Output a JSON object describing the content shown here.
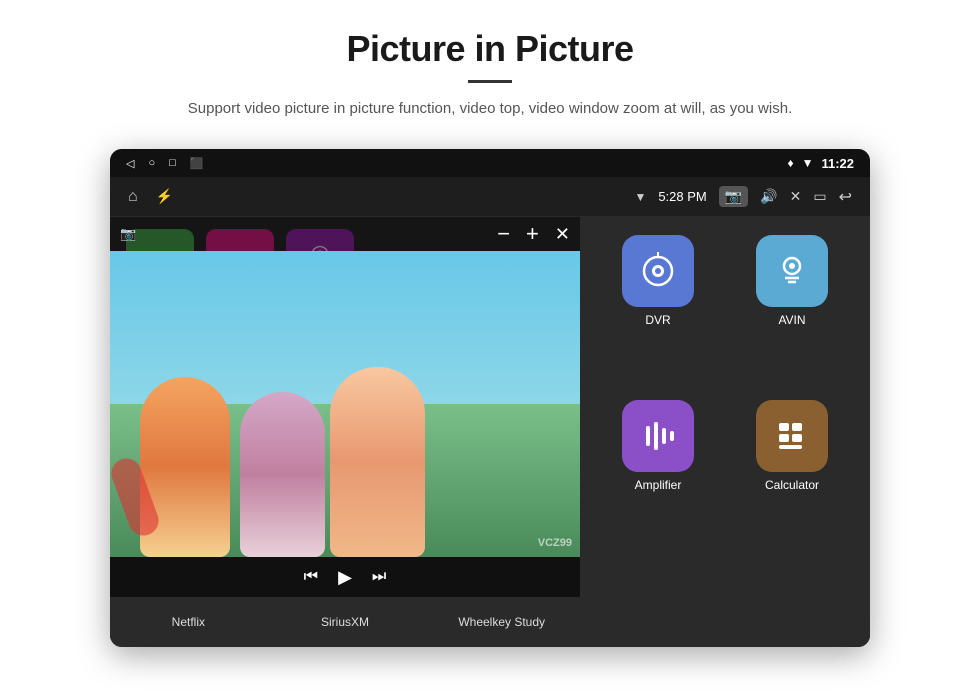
{
  "header": {
    "title": "Picture in Picture",
    "subtitle": "Support video picture in picture function, video top, video window zoom at will, as you wish."
  },
  "statusBar": {
    "time": "11:22",
    "navTime": "5:28 PM"
  },
  "pip": {
    "minus": "−",
    "plus": "+",
    "close": "✕"
  },
  "apps": {
    "grid": [
      {
        "id": "dvr",
        "label": "DVR",
        "color": "#5878d4",
        "icon": "📡"
      },
      {
        "id": "avin",
        "label": "AVIN",
        "color": "#5aaad4",
        "icon": "🎮"
      },
      {
        "id": "amplifier",
        "label": "Amplifier",
        "color": "#8b50c8",
        "icon": "🎚"
      },
      {
        "id": "calculator",
        "label": "Calculator",
        "color": "#8b6030",
        "icon": "🧮"
      }
    ],
    "bottom": [
      {
        "id": "netflix",
        "label": "Netflix"
      },
      {
        "id": "siriusxm",
        "label": "SiriusXM"
      },
      {
        "id": "wheelkey",
        "label": "Wheelkey Study"
      }
    ]
  },
  "watermark": "VCZ99"
}
